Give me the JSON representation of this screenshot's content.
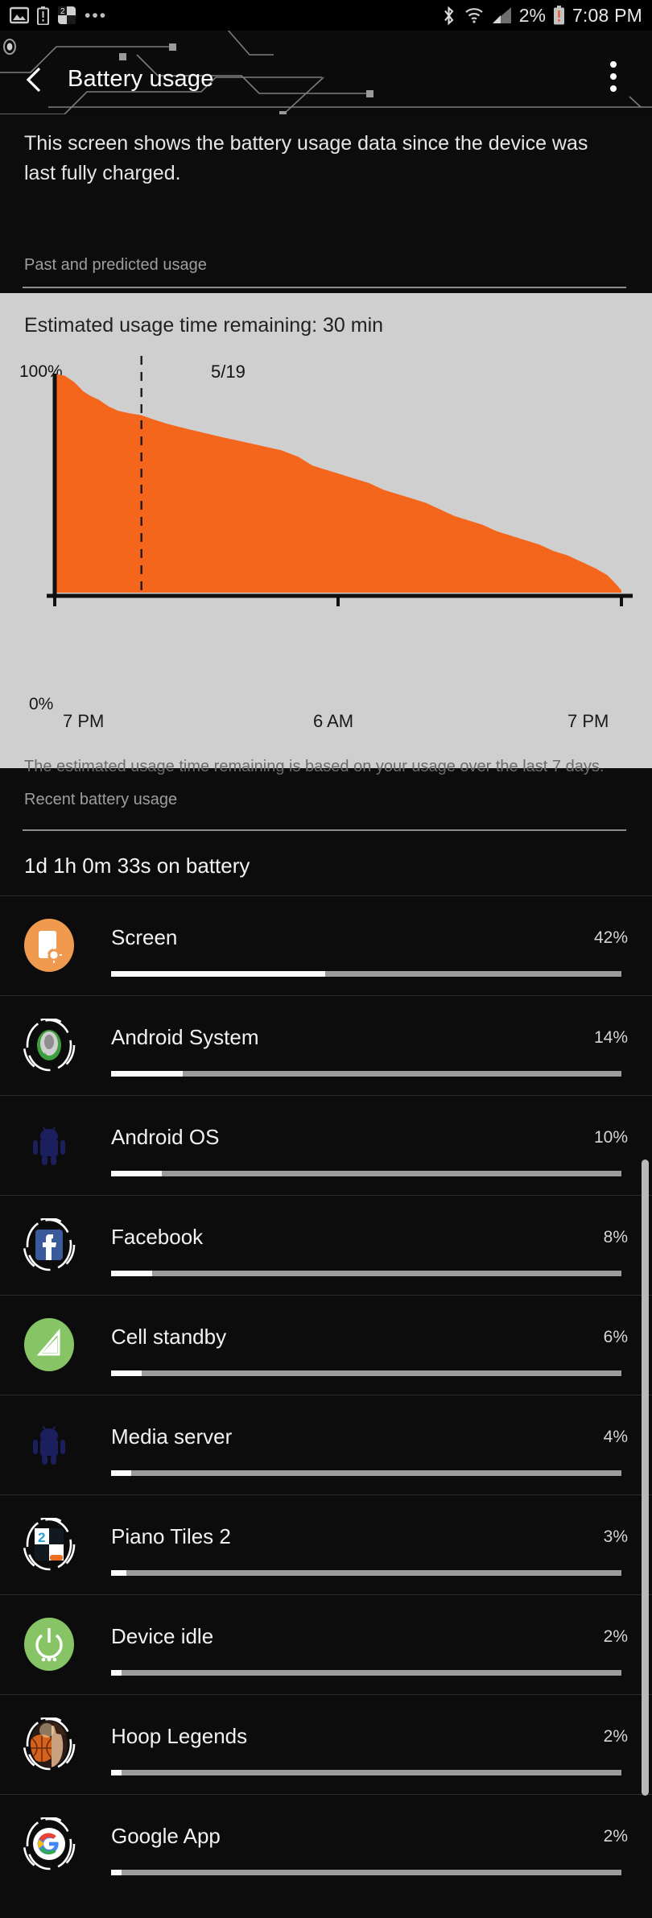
{
  "status_bar": {
    "left_icons": [
      "image-icon",
      "battery-alert-icon",
      "piano-tiles-notification-icon",
      "more-notifications-icon"
    ],
    "bluetooth_icon": "bluetooth-icon",
    "wifi_icon": "wifi-icon",
    "signal_icon": "cellular-signal-icon",
    "battery_percent": "2%",
    "battery_icon": "battery-low-icon",
    "time": "7:08 PM"
  },
  "action_bar": {
    "back_icon": "back-arrow-icon",
    "title": "Battery usage",
    "overflow_icon": "overflow-menu-icon"
  },
  "intro": {
    "text": "This screen shows the battery usage data since the device was last fully charged."
  },
  "past_section": {
    "label": "Past and predicted usage",
    "estimate": "Estimated usage time remaining: 30 min",
    "note": "The estimated usage time remaining is based on your usage over the last 7 days."
  },
  "chart_data": {
    "type": "area",
    "title": "Estimated usage time remaining: 30 min",
    "xlabel": "",
    "ylabel": "",
    "ylim": [
      0,
      100
    ],
    "ytick_labels": [
      "100%",
      "0%"
    ],
    "xtick_labels": [
      "7 PM",
      "6 AM",
      "7 PM"
    ],
    "xtick_positions": [
      0,
      0.5,
      1.0
    ],
    "grid": false,
    "legend": false,
    "series_color": "#f4661b",
    "annotations": [
      {
        "label": "5/19",
        "type": "dashed-vline",
        "x_fraction": 0.153
      }
    ],
    "series": [
      {
        "name": "Battery level",
        "x": [
          0.0,
          0.018,
          0.035,
          0.05,
          0.062,
          0.078,
          0.095,
          0.112,
          0.13,
          0.153,
          0.175,
          0.2,
          0.23,
          0.262,
          0.295,
          0.33,
          0.365,
          0.4,
          0.43,
          0.455,
          0.48,
          0.505,
          0.53,
          0.555,
          0.58,
          0.605,
          0.63,
          0.655,
          0.68,
          0.705,
          0.73,
          0.755,
          0.78,
          0.805,
          0.83,
          0.855,
          0.88,
          0.905,
          0.93,
          0.955,
          0.975,
          0.99,
          1.0
        ],
        "values": [
          100,
          99,
          96,
          92,
          90,
          88,
          85,
          83,
          82,
          81,
          79,
          77,
          75,
          73,
          71,
          69,
          67,
          65,
          62,
          58,
          56,
          54,
          52,
          50,
          47,
          45,
          43,
          41,
          38,
          35,
          33,
          31,
          28,
          26,
          24,
          22,
          19,
          17,
          14,
          11,
          8,
          4,
          1
        ]
      }
    ]
  },
  "recent_section": {
    "label": "Recent battery usage",
    "on_battery": "1d 1h 0m 33s on battery"
  },
  "apps": [
    {
      "name": "Screen",
      "percent": "42%",
      "value": 42,
      "icon": "screen-brightness-icon",
      "icon_kind": "screen"
    },
    {
      "name": "Android System",
      "percent": "14%",
      "value": 14,
      "icon": "android-system-icon",
      "icon_kind": "android-system"
    },
    {
      "name": "Android OS",
      "percent": "10%",
      "value": 10,
      "icon": "android-os-icon",
      "icon_kind": "android-dim"
    },
    {
      "name": "Facebook",
      "percent": "8%",
      "value": 8,
      "icon": "facebook-icon",
      "icon_kind": "facebook"
    },
    {
      "name": "Cell standby",
      "percent": "6%",
      "value": 6,
      "icon": "cell-standby-icon",
      "icon_kind": "cell"
    },
    {
      "name": "Media server",
      "percent": "4%",
      "value": 4,
      "icon": "media-server-icon",
      "icon_kind": "android-dim"
    },
    {
      "name": "Piano Tiles 2",
      "percent": "3%",
      "value": 3,
      "icon": "piano-tiles-2-icon",
      "icon_kind": "piano"
    },
    {
      "name": "Device idle",
      "percent": "2%",
      "value": 2,
      "icon": "device-idle-power-icon",
      "icon_kind": "idle"
    },
    {
      "name": "Hoop Legends",
      "percent": "2%",
      "value": 2,
      "icon": "hoop-legends-icon",
      "icon_kind": "hoop"
    },
    {
      "name": "Google App",
      "percent": "2%",
      "value": 2,
      "icon": "google-app-icon",
      "icon_kind": "google"
    }
  ],
  "colors": {
    "accent_orange": "#f4661b",
    "card_bg": "#cfcfcf",
    "page_bg": "#0c0c0c",
    "bar_track": "#9b9b9b",
    "bar_fill": "#fbfbfb"
  }
}
